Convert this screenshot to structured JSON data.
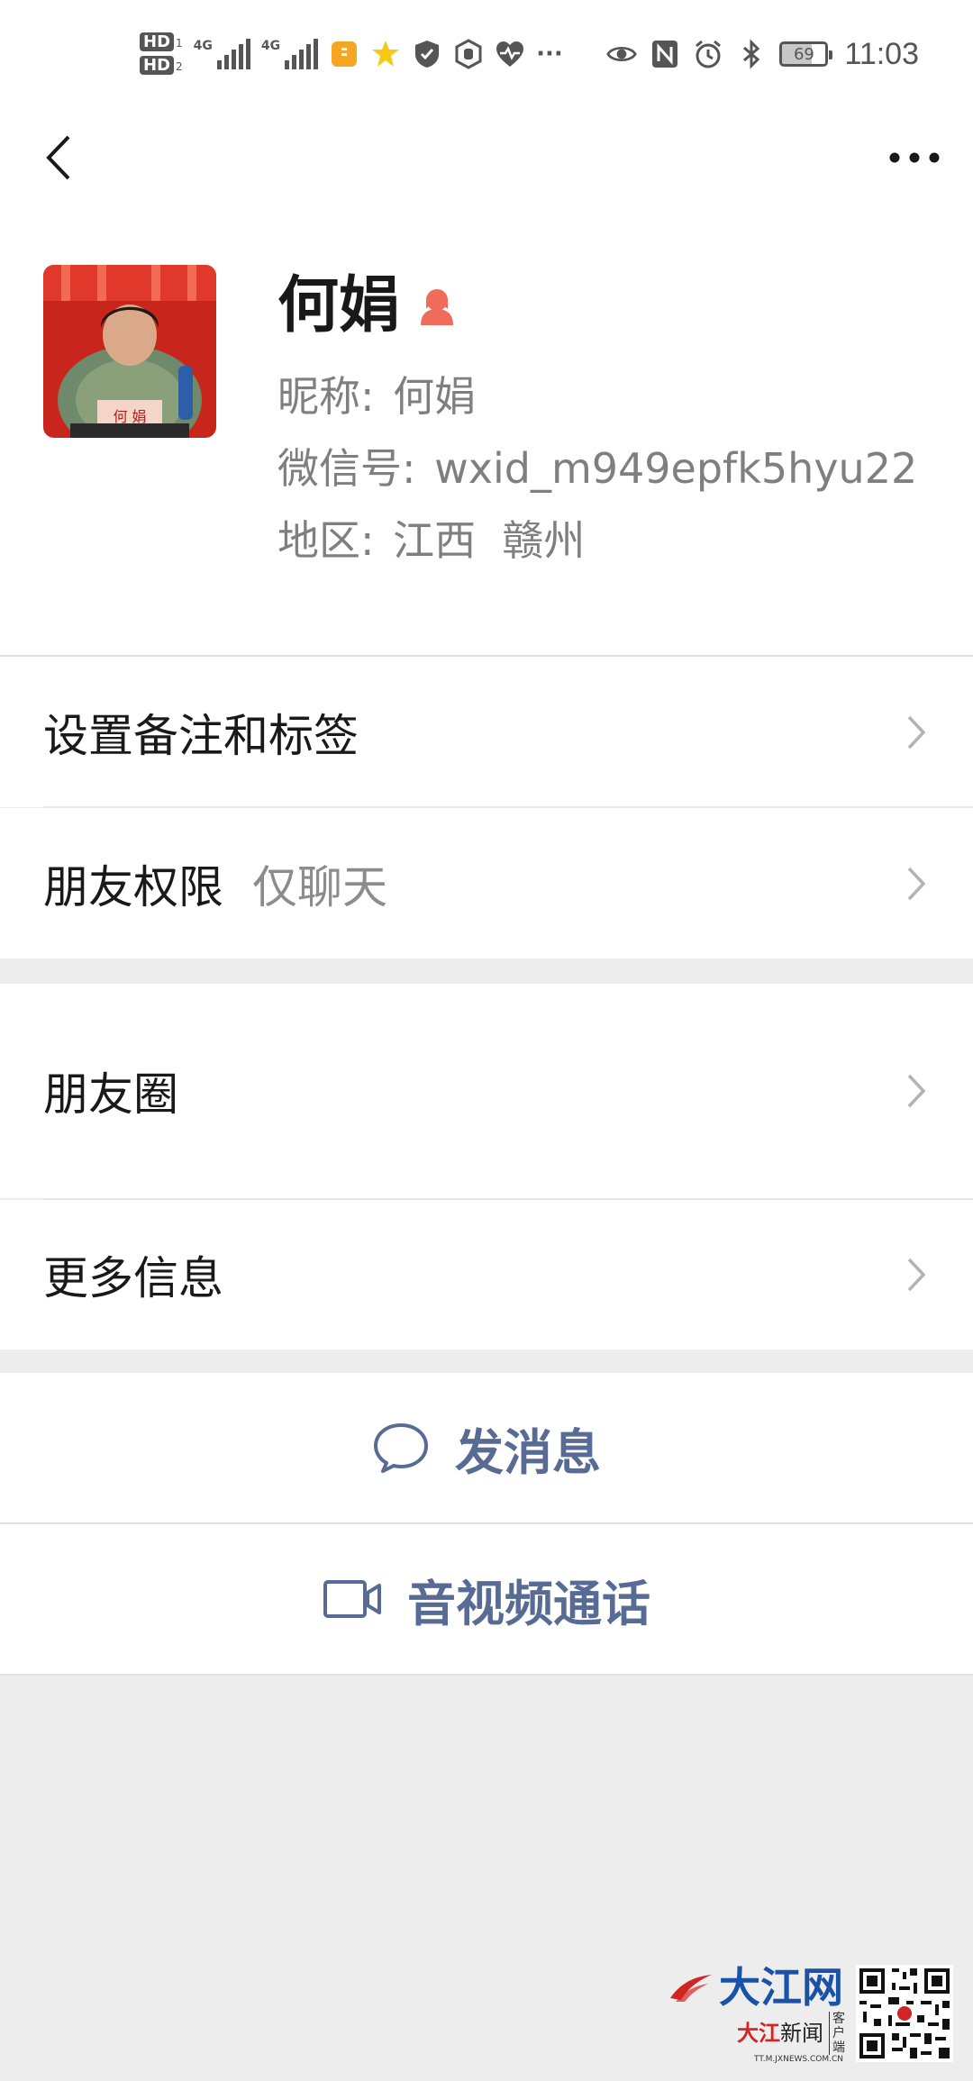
{
  "status_bar": {
    "hd1": "HD",
    "hd1_sub": "1",
    "hd2": "HD",
    "hd2_sub": "2",
    "net1": "4G",
    "net2": "4G",
    "more": "···",
    "battery": "69",
    "time": "11:03"
  },
  "profile": {
    "name": "何娟",
    "nickname_label": "昵称:",
    "nickname": "何娟",
    "wechat_id_label": "微信号:",
    "wechat_id": "wxid_m949epfk5hyu22",
    "region_label": "地区:",
    "region": "江西  赣州",
    "avatar_sign": "何  娟"
  },
  "menu": {
    "remark_tags": "设置备注和标签",
    "permissions": "朋友权限",
    "permissions_value": "仅聊天",
    "moments": "朋友圈",
    "more_info": "更多信息"
  },
  "actions": {
    "message": "发消息",
    "call": "音视频通话"
  },
  "watermark": {
    "brand": "大江网",
    "sub_red": "大江",
    "sub_black": "新闻",
    "side": "客户端",
    "url": "TT.M.JXNEWS.COM.CN"
  },
  "colors": {
    "link": "#576b95",
    "gender_icon": "#f06b5a",
    "background": "#ededed"
  }
}
